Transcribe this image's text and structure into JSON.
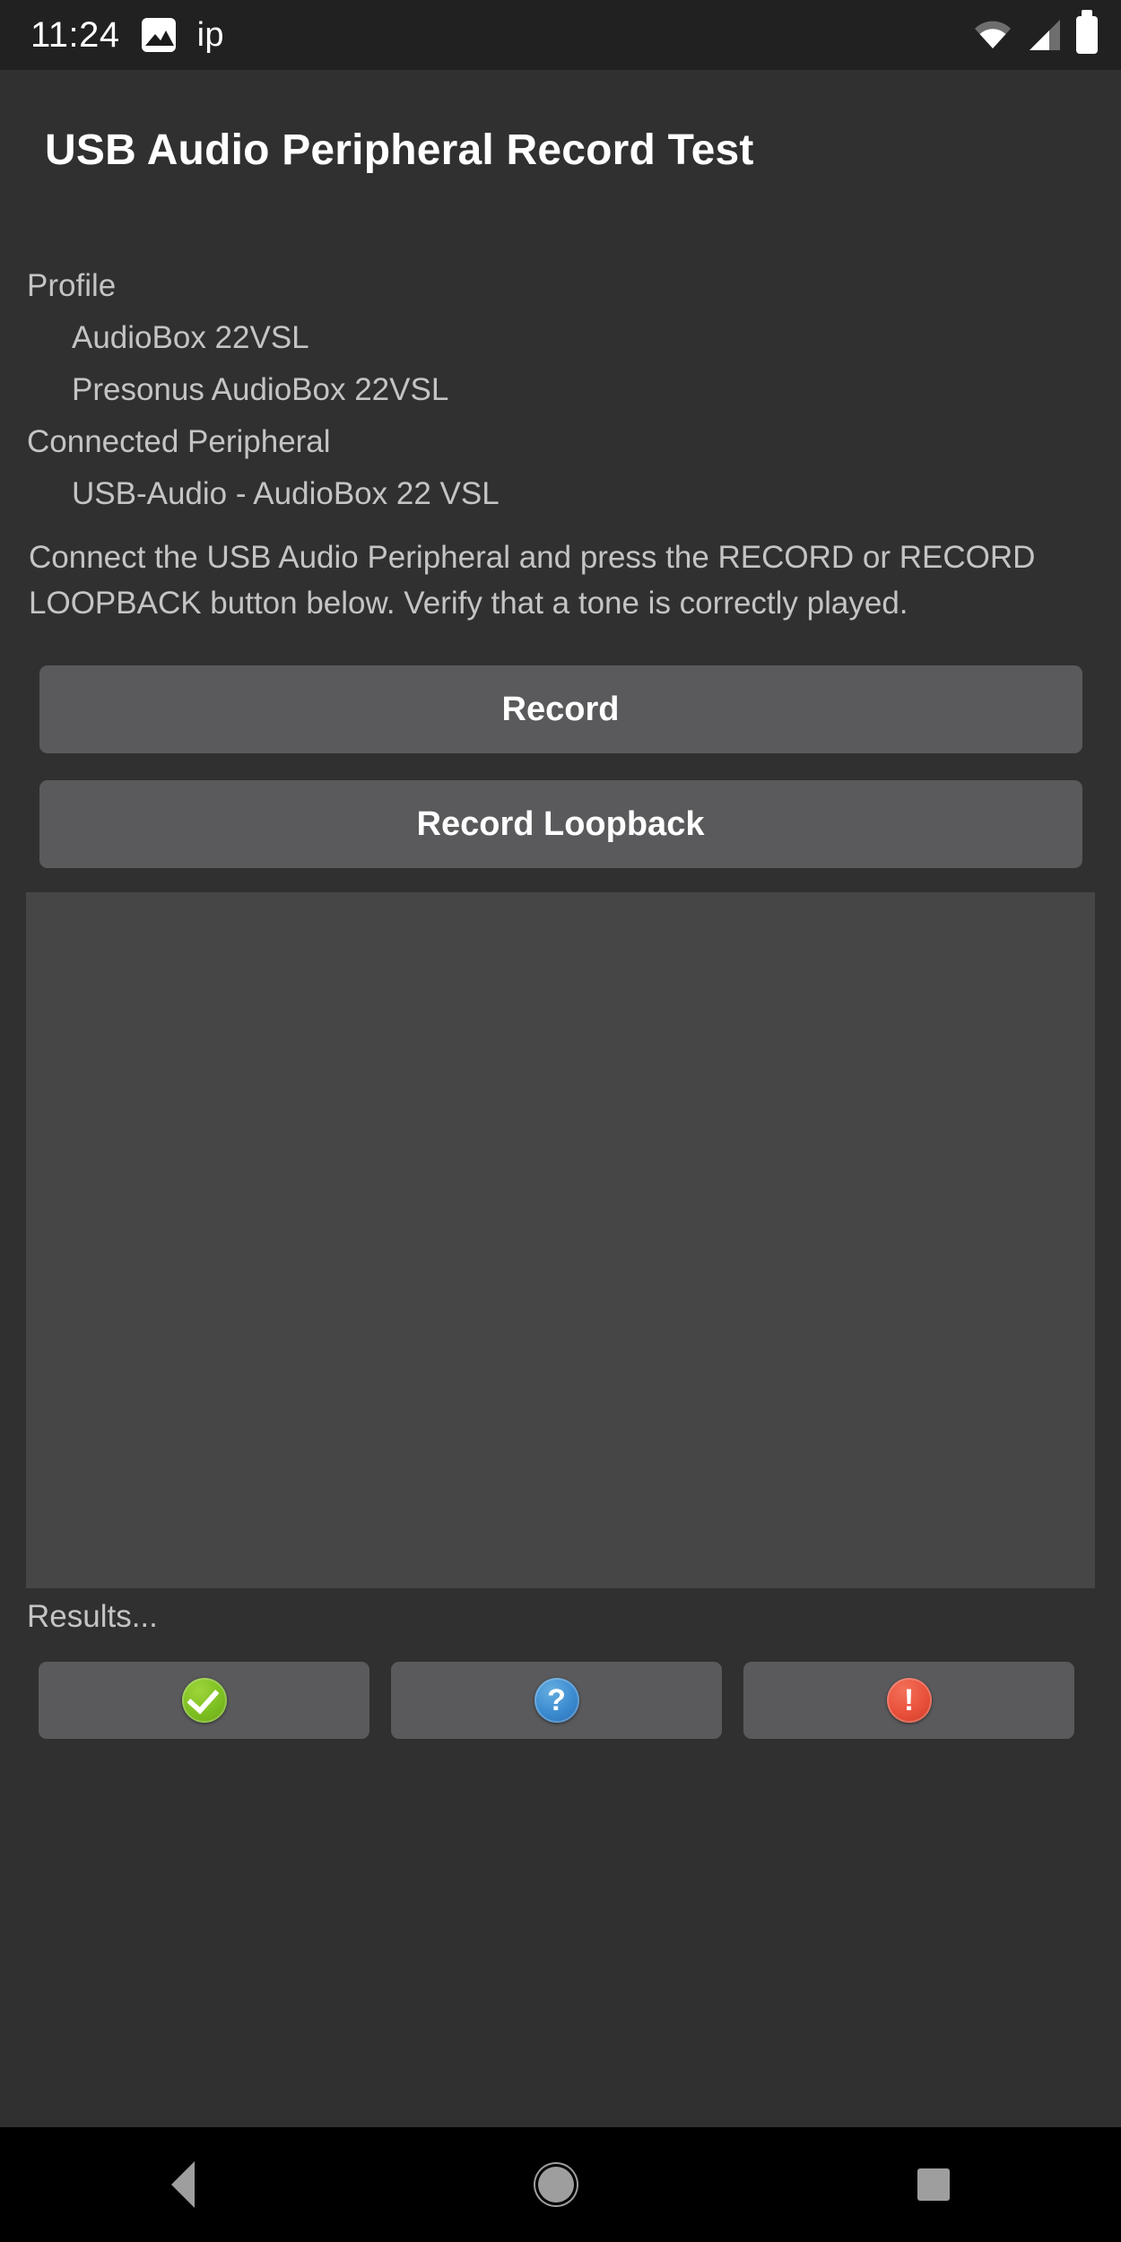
{
  "status_bar": {
    "clock": "11:24",
    "notification_label": "ip",
    "icons": [
      "photo-icon",
      "wifi-icon",
      "cell-signal-icon",
      "battery-icon"
    ]
  },
  "header": {
    "title": "USB Audio Peripheral Record Test"
  },
  "info": {
    "profile_label": "Profile",
    "profile_name": "AudioBox 22VSL",
    "profile_product": "Presonus AudioBox 22VSL",
    "connected_label": "Connected Peripheral",
    "connected_device": "USB-Audio - AudioBox 22 VSL"
  },
  "instructions": "Connect the USB Audio Peripheral and press the RECORD or RECORD LOOPBACK button below. Verify that a tone is correctly played.",
  "actions": {
    "record_label": "Record",
    "record_loopback_label": "Record Loopback"
  },
  "results": {
    "label": "Results...",
    "pass_icon": "check-circle-icon",
    "info_icon": "question-circle-icon",
    "fail_icon": "exclamation-circle-icon",
    "info_glyph": "?",
    "fail_glyph": "!"
  },
  "nav_bar": {
    "back": "back-triangle-icon",
    "home": "home-circle-icon",
    "recents": "recents-square-icon"
  },
  "colors": {
    "background": "#303030",
    "status_bar": "#212121",
    "button": "#5a5a5c",
    "panel": "#464646",
    "text_primary": "#ffffff",
    "text_secondary": "#c4c4c4",
    "pass_green": "#7cbf20",
    "info_blue": "#3a8ad0",
    "fail_red": "#e8503a",
    "nav_icon": "#9e9e9e"
  }
}
